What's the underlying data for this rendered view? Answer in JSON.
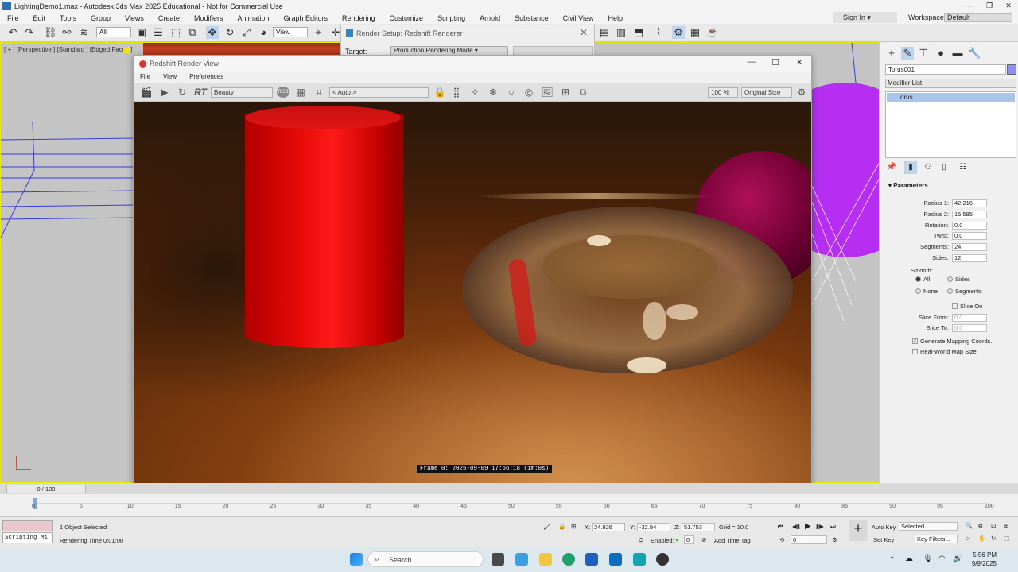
{
  "window": {
    "title": "LightingDemo1.max - Autodesk 3ds Max 2025 Educational - Not for Commercial Use",
    "controls": [
      "—",
      "❐",
      "✕"
    ]
  },
  "menubar": {
    "items": [
      "File",
      "Edit",
      "Tools",
      "Group",
      "Views",
      "Create",
      "Modifiers",
      "Animation",
      "Graph Editors",
      "Rendering",
      "Customize",
      "Scripting",
      "Arnold",
      "Substance",
      "Civil View",
      "Help"
    ],
    "sign_in": "Sign In",
    "workspaces_label": "Workspaces:",
    "workspace_value": "Default"
  },
  "toolbar": {
    "selection_filter": "All",
    "ref_coord": "View"
  },
  "viewport": {
    "label": "[ + ] [Perspective ] [Standard ] [Edged Faces ]"
  },
  "render_setup": {
    "title": "Render Setup: Redshift Renderer",
    "target_label": "Target:",
    "target_value": "Production Rendering Mode"
  },
  "render_view": {
    "title": "Redshift Render View",
    "menu": [
      "File",
      "View",
      "Preferences"
    ],
    "rt_label": "RT",
    "aov": "Beauty",
    "rgb_badge": "RGB",
    "camera": "< Auto >",
    "zoom": "100 %",
    "size_mode": "Original Size",
    "frame_stamp": "Frame 0:  2025-09-09  17:56:18  (1m:0s)"
  },
  "command_panel": {
    "object_name": "Torus001",
    "object_color": "#8e8ef0",
    "modifier_list": "Modifier List",
    "stack": [
      "Torus"
    ],
    "parameters_header": "Parameters",
    "params": [
      {
        "label": "Radius 1:",
        "value": "42.216"
      },
      {
        "label": "Radius 2:",
        "value": "15.595"
      },
      {
        "label": "Rotation:",
        "value": "0.0"
      },
      {
        "label": "Twist:",
        "value": "0.0"
      },
      {
        "label": "Segments:",
        "value": "24"
      },
      {
        "label": "Sides:",
        "value": "12"
      }
    ],
    "smooth_label": "Smooth:",
    "smooth_options": [
      "All",
      "Sides",
      "None",
      "Segments"
    ],
    "slice_on": "Slice On",
    "slice_from_label": "Slice From:",
    "slice_from": "0.0",
    "slice_to_label": "Slice To:",
    "slice_to": "0.0",
    "gen_mapping": "Generate Mapping Coords.",
    "real_world": "Real-World Map Size"
  },
  "timeline": {
    "frame_display": "0 / 100",
    "ticks": [
      "0",
      "5",
      "10",
      "15",
      "20",
      "25",
      "30",
      "35",
      "40",
      "45",
      "50",
      "55",
      "60",
      "65",
      "70",
      "75",
      "80",
      "85",
      "90",
      "95",
      "100"
    ]
  },
  "status": {
    "selection": "1 Object Selected",
    "render_time": "Rendering Time  0:01:00",
    "script_label": "Scripting Mi",
    "x_label": "X:",
    "x": "24.926",
    "y_label": "Y:",
    "y": "-32.94",
    "z_label": "Z:",
    "z": "51.753",
    "grid": "Grid = 10.0",
    "enabled": "Enabled:",
    "add_time_tag": "Add Time Tag",
    "auto_key": "Auto Key",
    "set_key": "Set Key",
    "key_mode": "Selected",
    "key_filters": "Key Filters...",
    "frame_field": "0"
  },
  "taskbar": {
    "search": "Search",
    "time": "5:56 PM",
    "date": "9/9/2025"
  }
}
